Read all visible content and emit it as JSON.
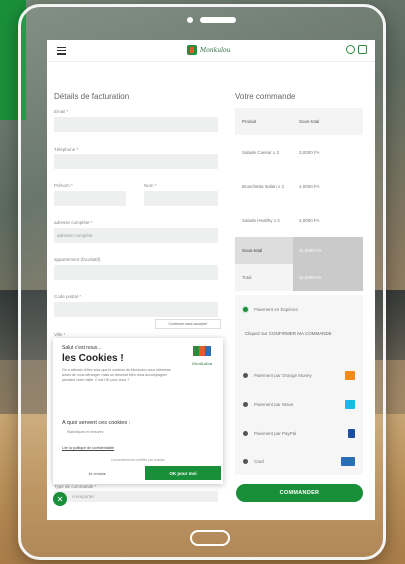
{
  "navbar": {
    "logo_text": "Monkulou"
  },
  "billing": {
    "title": "Détails de facturation",
    "email_label": "Email *",
    "phone_label": "Téléphone *",
    "firstname_label": "Prénom *",
    "lastname_label": "Nom *",
    "address_label": "adresse complète *",
    "address_placeholder": "adresse complète",
    "apartment_label": "appartement (facultatif)",
    "postal_label": "Code postal *",
    "city_label": "Ville *",
    "order_type_label": "Type de commande *",
    "order_type_value": "A emporter"
  },
  "tooltip": "Continuer sans accepter",
  "order": {
    "title": "Votre commande",
    "col_product": "Produit",
    "col_subtotal": "Sous-total",
    "items": [
      {
        "name": "Salade Caesar x 2",
        "price": "3,0000 FA"
      },
      {
        "name": "Bruschetta Italian x 2",
        "price": "4,0000 FA"
      },
      {
        "name": "Salade Healthy x 2",
        "price": "4,0000 FA"
      }
    ],
    "subtotal_label": "Sous-total",
    "subtotal_value": "11,0000 FA",
    "total_label": "Total",
    "total_value": "11,0000 FA"
  },
  "payment": {
    "cash_label": "Paiement en Espèces",
    "note": "Cliquez sur CONFIRMER MA COMMANDE",
    "options": [
      {
        "label": "Paiement par Orange Money",
        "icon": "orange-money-icon",
        "color": "#f28a1a"
      },
      {
        "label": "Paiement par Wave",
        "icon": "wave-icon",
        "color": "#1db6e8"
      },
      {
        "label": "Paiement par PayPal",
        "icon": "paypal-icon",
        "color": "#1d4fa0"
      },
      {
        "label": "Card",
        "icon": "card-icon",
        "color": "#2a6fb5"
      }
    ]
  },
  "order_button": "COMMANDER",
  "cookie": {
    "greeting": "Salut c'est nous...",
    "title": "les Cookies !",
    "logo_text": "Monkulou",
    "body": "On a attendu d'être sûrs que le contenu de Monkulou vous intéresse avant de vous déranger, mais on aimerait bien vous accompagner pendant votre visite. C'est OK pour vous ?",
    "subtitle": "A quoi servent ces cookies :",
    "subtitle_small": "Statistiques et mesures",
    "policy": "Lire la politique de confidentialité",
    "consent": "Consentements certifiés par Axeptio",
    "refuse": "Je choisis",
    "accept": "OK pour moi"
  },
  "colors": {
    "accent": "#1a8f3a"
  }
}
